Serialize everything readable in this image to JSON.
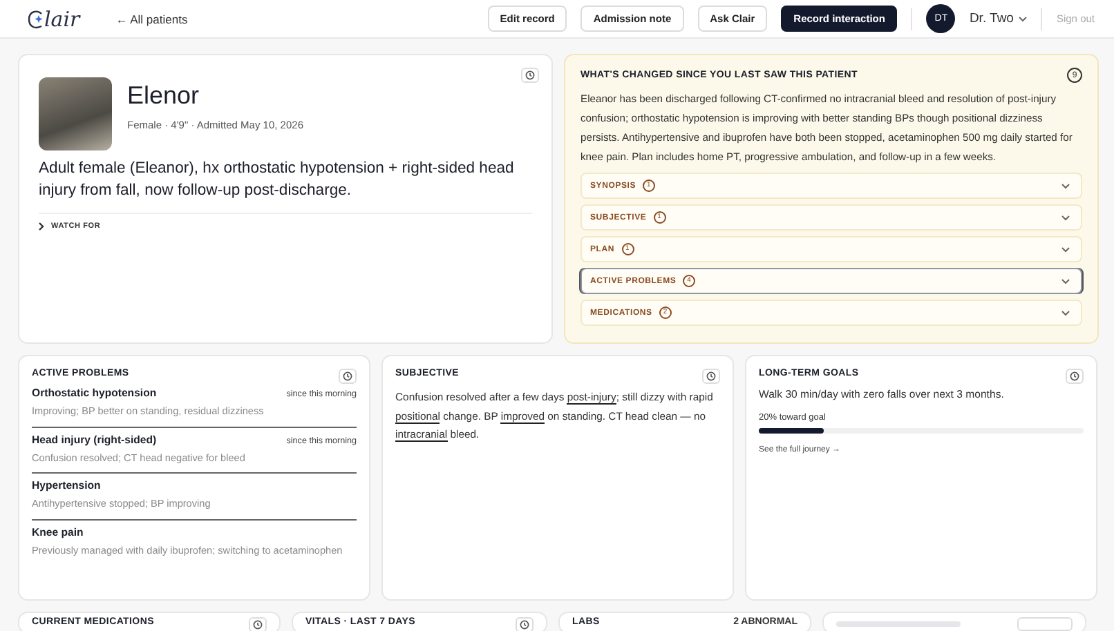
{
  "header": {
    "logo": "lair",
    "back_link": "← All patients",
    "actions": [
      {
        "label": "Edit record",
        "primary": false
      },
      {
        "label": "Admission note",
        "primary": false
      },
      {
        "label": "Ask Clair",
        "primary": false
      },
      {
        "label": "Record interaction",
        "primary": true
      }
    ],
    "user": {
      "initials": "DT",
      "name": "Dr. Two"
    },
    "sign_out": "Sign out"
  },
  "patient": {
    "name": "Elenor",
    "meta": "Female · 4'9\" · Admitted May 10, 2026",
    "summary": "Adult female (Eleanor), hx orthostatic hypotension + right-sided head injury from fall, now follow-up post-discharge.",
    "watch_for": "WATCH FOR"
  },
  "changes": {
    "title": "WHAT'S CHANGED SINCE YOU LAST SAW THIS PATIENT",
    "count": "9",
    "summary": "Eleanor has been discharged following CT-confirmed no intracranial bleed and resolution of post-injury confusion; orthostatic hypotension is improving with better standing BPs though positional dizziness persists. Antihypertensive and ibuprofen have both been stopped, acetaminophen 500 mg daily started for knee pain. Plan includes home PT, progressive ambulation, and follow-up in a few weeks.",
    "sections": [
      {
        "label": "SYNOPSIS",
        "count": "1",
        "selected": false
      },
      {
        "label": "SUBJECTIVE",
        "count": "1",
        "selected": false
      },
      {
        "label": "PLAN",
        "count": "1",
        "selected": false
      },
      {
        "label": "ACTIVE PROBLEMS",
        "count": "4",
        "selected": true
      },
      {
        "label": "MEDICATIONS",
        "count": "2",
        "selected": false
      }
    ]
  },
  "active_problems": {
    "title": "ACTIVE PROBLEMS",
    "items": [
      {
        "name": "Orthostatic hypotension",
        "since": "since this morning",
        "note": "Improving; BP better on standing, residual dizziness"
      },
      {
        "name": "Head injury (right-sided)",
        "since": "since this morning",
        "note": "Confusion resolved; CT head negative for bleed"
      },
      {
        "name": "Hypertension",
        "note": "Antihypertensive stopped; BP improving"
      },
      {
        "name": "Knee pain",
        "note": "Previously managed with daily ibuprofen; switching to acetaminophen"
      }
    ]
  },
  "subjective": {
    "title": "SUBJECTIVE",
    "parts": [
      {
        "text": "Confusion resolved after a few days ",
        "underlined": false
      },
      {
        "text": "post-injury",
        "underlined": true
      },
      {
        "text": "; still dizzy with rapid ",
        "underlined": false
      },
      {
        "text": "positional",
        "underlined": true
      },
      {
        "text": " change. BP ",
        "underlined": false
      },
      {
        "text": "improved",
        "underlined": true
      },
      {
        "text": " on standing. CT head clean — no ",
        "underlined": false
      },
      {
        "text": "intracranial",
        "underlined": true
      },
      {
        "text": " bleed.",
        "underlined": false
      }
    ]
  },
  "goals": {
    "title": "LONG-TERM GOALS",
    "goal": "Walk 30 min/day with zero falls over next 3 months.",
    "progress_label": "20% toward goal",
    "level": 0.2,
    "journey_link": "See the full journey →"
  },
  "bottom_cards": [
    {
      "title": "CURRENT MEDICATIONS",
      "kind": "history"
    },
    {
      "title": "VITALS · LAST 7 DAYS",
      "kind": "history"
    },
    {
      "title": "LABS",
      "badge": "2 ABNORMAL",
      "kind": "badge"
    },
    {
      "kind": "faded"
    }
  ]
}
